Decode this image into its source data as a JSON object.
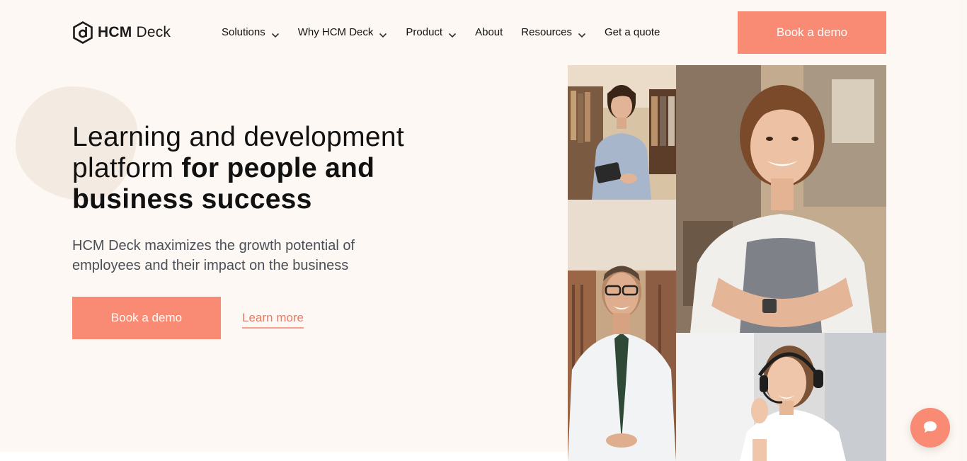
{
  "header": {
    "logo_primary": "HCM",
    "logo_secondary": "Deck",
    "nav": [
      {
        "label": "Solutions",
        "has_dropdown": true
      },
      {
        "label": "Why HCM Deck",
        "has_dropdown": true
      },
      {
        "label": "Product",
        "has_dropdown": true
      },
      {
        "label": "About",
        "has_dropdown": false
      },
      {
        "label": "Resources",
        "has_dropdown": true
      },
      {
        "label": "Get a quote",
        "has_dropdown": false
      }
    ],
    "cta_label": "Book a demo"
  },
  "hero": {
    "headline_regular": "Learning and development platform ",
    "headline_bold": "for people and business success",
    "subtext": "HCM Deck maximizes the growth potential of employees and their impact on the business",
    "primary_cta": "Book a demo",
    "secondary_cta": "Learn more"
  },
  "icons": {
    "logo": "hcm-deck-logo-icon",
    "dropdown": "chevron-down-icon",
    "chat": "chat-bubble-icon"
  },
  "colors": {
    "accent": "#f98a73",
    "link": "#ee7a62",
    "background": "#fdf8f3",
    "text": "#111111",
    "muted_text": "#4a4f57"
  }
}
